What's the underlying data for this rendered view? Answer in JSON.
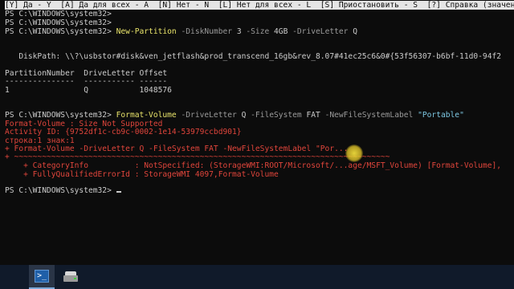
{
  "prompt_bar": "[Y] Да - Y  [A] Да для всех - A  [N] Нет - N  [L] Нет для всех - L  [S] Приостановить - S  [?] Справка (значени",
  "lines": {
    "l1": "PS C:\\WINDOWS\\system32>",
    "l2": "PS C:\\WINDOWS\\system32>",
    "l3_prompt": "PS C:\\WINDOWS\\system32> ",
    "l3_cmd": "New-Partition",
    "l3_p1": " -DiskNumber ",
    "l3_v1": "3",
    "l3_p2": " -Size ",
    "l3_v2": "4GB",
    "l3_p3": " -DriveLetter ",
    "l3_v3": "Q",
    "diskpath": "   DiskPath: \\\\?\\usbstor#disk&ven_jetflash&prod_transcend_16gb&rev_8.07#41ec25c6&0#{53f56307-b6bf-11d0-94f2",
    "header": "PartitionNumber  DriveLetter Offset",
    "separator": "---------------  ----------- ------",
    "row": "1                Q           1048576",
    "fv_prompt": "PS C:\\WINDOWS\\system32> ",
    "fv_cmd": "Format-Volume",
    "fv_p1": " -DriveLetter ",
    "fv_v1": "Q",
    "fv_p2": " -FileSystem ",
    "fv_v2": "FAT",
    "fv_p3": " -NewFileSystemLabel ",
    "fv_v3": "\"Portable\"",
    "err1": "Format-Volume : Size Not Supported",
    "err2": "Activity ID: {9752df1c-cb9c-0002-1e14-53979ccbd901}",
    "err3": "строка:1 знак:1",
    "err4": "+ Format-Volume -DriveLetter Q -FileSystem FAT -NewFileSystemLabel \"Por...",
    "err5": "+ ~~~~~~~~~~~~~~~~~~~~~~~~~~~~~~~~~~~~~~~~~~~~~~~~~~~~~~~~~~~~~~~~~~~~~~~~~~~~~~~~~",
    "err6": "    + CategoryInfo          : NotSpecified: (StorageWMI:ROOT/Microsoft/...age/MSFT_Volume) [Format-Volume],",
    "err7": "    + FullyQualifiedErrorId : StorageWMI 4097,Format-Volume",
    "final_prompt": "PS C:\\WINDOWS\\system32> "
  },
  "taskbar": {
    "powershell_glyph": ">_"
  },
  "colors": {
    "background": "#0c0c0c",
    "text": "#cccccc",
    "command": "#e8e36a",
    "parameter": "#9a9a9a",
    "string": "#7ec8e3",
    "error": "#e0453b"
  }
}
